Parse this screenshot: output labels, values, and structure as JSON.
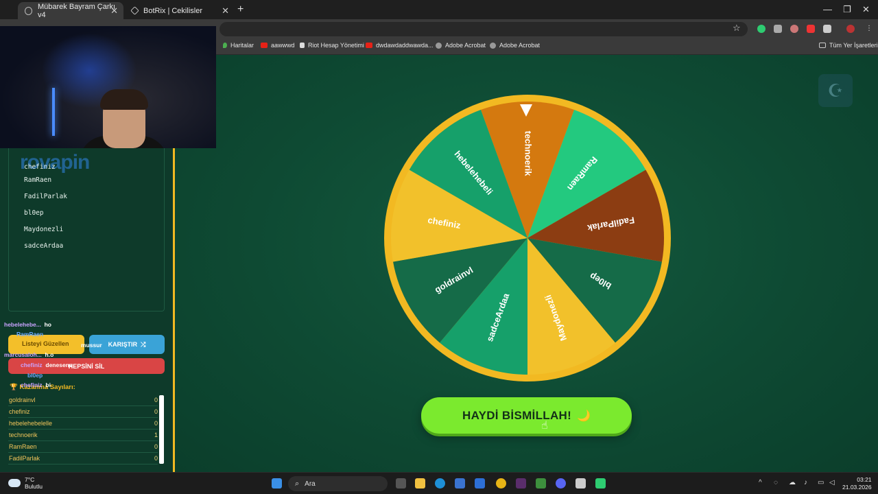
{
  "tabs": [
    {
      "label": "Mübarek Bayram Çarkı v4",
      "active": true
    },
    {
      "label": "BotRix | Cekilisler",
      "active": false
    }
  ],
  "bookmarks": [
    "Haritalar",
    "aawwwd",
    "Riot Hesap Yönetimi",
    "dwdawdaddwawda...",
    "Adobe Acrobat",
    "Adobe Acrobat"
  ],
  "bookmarks_all": "Tüm Yer İşaretleri",
  "participants": [
    "chefiniz",
    "RamRaen",
    "FadilParlak",
    "bl0ep",
    "Maydonezli",
    "sadceArdaa"
  ],
  "logo_text": "rovapin",
  "buttons": {
    "shuffle": "Listeyi Güzellen",
    "mix": "KARIŞTIR",
    "clear": "HEPSİNİ SİL",
    "spin": "HAYDİ BİSMİLLAH!"
  },
  "chat": [
    {
      "user": "hebelehebe...",
      "msg": "ho",
      "color": "#c9a3ff"
    },
    {
      "user": "RamRaen",
      "msg": "",
      "color": "#6aa8ff"
    },
    {
      "user": "marcusaloh...",
      "msg": "h.o",
      "color": "#c9a3ff"
    },
    {
      "user": "chefiniz",
      "msg": "denesene",
      "color": "#c9a3ff"
    },
    {
      "user": "bl0ep",
      "msg": "",
      "color": "#6aa8ff"
    },
    {
      "user": "chefiniz",
      "msg": "bi",
      "color": "#c9a3ff"
    },
    {
      "user": "hebelehebe...",
      "msg": "mussur",
      "color": "#c9a3ff"
    }
  ],
  "wins_title": "Kazanma Sayıları:",
  "wins": [
    {
      "name": "goldrainvl",
      "count": "0"
    },
    {
      "name": "chefiniz",
      "count": "0"
    },
    {
      "name": "hebelehebelelle",
      "count": "0"
    },
    {
      "name": "technoerik",
      "count": "1"
    },
    {
      "name": "RamRaen",
      "count": "0"
    },
    {
      "name": "FadilParlak",
      "count": "0"
    }
  ],
  "wheel": {
    "segments": [
      {
        "label": "technoerik",
        "color": "#d4790f"
      },
      {
        "label": "RamRaen",
        "color": "#23c97f"
      },
      {
        "label": "FadilParlak",
        "color": "#8c3d12"
      },
      {
        "label": "bl0ep",
        "color": "#156b48"
      },
      {
        "label": "Maydonezli",
        "color": "#f2c12b"
      },
      {
        "label": "sadceArdaa",
        "color": "#16a06a"
      },
      {
        "label": "goldrainvl",
        "color": "#156b48"
      },
      {
        "label": "chefiniz",
        "color": "#f2c12b"
      },
      {
        "label": "hebelehebeli",
        "color": "#16a06a"
      }
    ],
    "rim_color": "#f2b922"
  },
  "taskbar": {
    "temp": "7°C",
    "weather": "Bulutlu",
    "search": "Ara",
    "time": "03:21",
    "date": "21.03.2026"
  }
}
